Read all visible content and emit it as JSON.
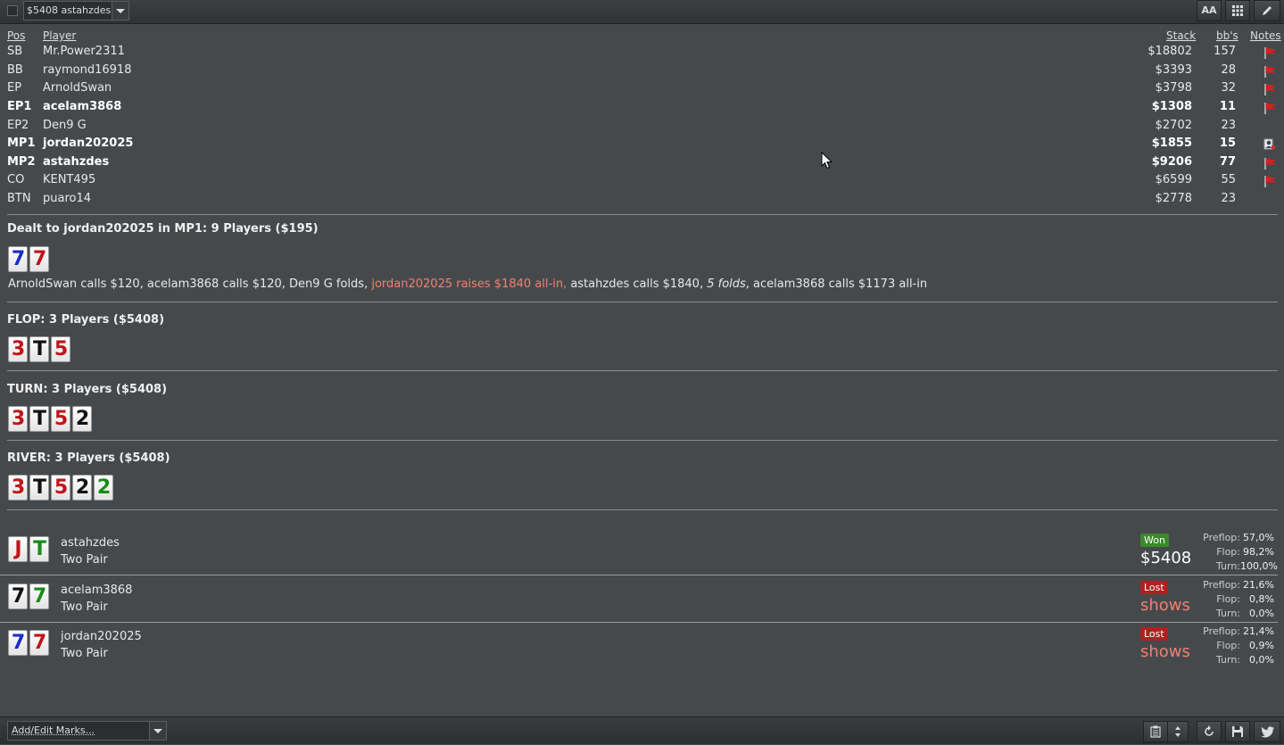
{
  "topbar": {
    "hand_select": "$5408 astahzdes",
    "icons": [
      "font-size-icon",
      "grid-icon",
      "pencil-icon"
    ],
    "font_label": "AA"
  },
  "table": {
    "headers": {
      "pos": "Pos",
      "player": "Player",
      "stack": "Stack",
      "bbs": "bb's",
      "notes": "Notes"
    },
    "rows": [
      {
        "pos": "SB",
        "player": "Mr.Power2311",
        "stack": "$18802",
        "bbs": "157",
        "bold": false,
        "note": "flag"
      },
      {
        "pos": "BB",
        "player": "raymond16918",
        "stack": "$3393",
        "bbs": "28",
        "bold": false,
        "note": "flag"
      },
      {
        "pos": "EP",
        "player": "ArnoldSwan",
        "stack": "$3798",
        "bbs": "32",
        "bold": false,
        "note": "flag"
      },
      {
        "pos": "EP1",
        "player": "acelam3868",
        "stack": "$1308",
        "bbs": "11",
        "bold": true,
        "note": "flag"
      },
      {
        "pos": "EP2",
        "player": "Den9 G",
        "stack": "$2702",
        "bbs": "23",
        "bold": false,
        "note": ""
      },
      {
        "pos": "MP1",
        "player": "jordan202025",
        "stack": "$1855",
        "bbs": "15",
        "bold": true,
        "note": "hero"
      },
      {
        "pos": "MP2",
        "player": "astahzdes",
        "stack": "$9206",
        "bbs": "77",
        "bold": true,
        "note": "flag"
      },
      {
        "pos": "CO",
        "player": "KENT495",
        "stack": "$6599",
        "bbs": "55",
        "bold": false,
        "note": "flag"
      },
      {
        "pos": "BTN",
        "player": "puaro14",
        "stack": "$2778",
        "bbs": "23",
        "bold": false,
        "note": ""
      }
    ]
  },
  "preflop": {
    "title": "Dealt to jordan202025 in MP1: 9 Players ($195)",
    "cards": [
      {
        "rank": "7",
        "suit": "d"
      },
      {
        "rank": "7",
        "suit": "h"
      }
    ],
    "actions": [
      {
        "text": "ArnoldSwan calls $120, acelam3868 calls $120, Den9 G folds, ",
        "style": ""
      },
      {
        "text": "jordan202025 raises $1840 all-in,",
        "style": "hl"
      },
      {
        "text": " astahzdes calls $1840, ",
        "style": ""
      },
      {
        "text": "5 folds",
        "style": "it"
      },
      {
        "text": ", acelam3868 calls $1173 all-in",
        "style": ""
      }
    ]
  },
  "flop": {
    "title": "FLOP: 3 Players ($5408)",
    "cards": [
      {
        "rank": "3",
        "suit": "h"
      },
      {
        "rank": "T",
        "suit": "s"
      },
      {
        "rank": "5",
        "suit": "h"
      }
    ]
  },
  "turn": {
    "title": "TURN: 3 Players ($5408)",
    "cards": [
      {
        "rank": "3",
        "suit": "h"
      },
      {
        "rank": "T",
        "suit": "s"
      },
      {
        "rank": "5",
        "suit": "h"
      },
      {
        "rank": "2",
        "suit": "s"
      }
    ]
  },
  "river": {
    "title": "RIVER: 3 Players ($5408)",
    "cards": [
      {
        "rank": "3",
        "suit": "h"
      },
      {
        "rank": "T",
        "suit": "s"
      },
      {
        "rank": "5",
        "suit": "h"
      },
      {
        "rank": "2",
        "suit": "s"
      },
      {
        "rank": "2",
        "suit": "c"
      }
    ]
  },
  "showdown": [
    {
      "player": "astahzdes",
      "hand": "Two Pair",
      "cards": [
        {
          "rank": "J",
          "suit": "h"
        },
        {
          "rank": "T",
          "suit": "c"
        }
      ],
      "result": "Won",
      "amount": "$5408",
      "equity": [
        {
          "k": "Preflop:",
          "v": "57,0%"
        },
        {
          "k": "Flop:",
          "v": "98,2%"
        },
        {
          "k": "Turn:",
          "v": "100,0%"
        }
      ]
    },
    {
      "player": "acelam3868",
      "hand": "Two Pair",
      "cards": [
        {
          "rank": "7",
          "suit": "s"
        },
        {
          "rank": "7",
          "suit": "c"
        }
      ],
      "result": "Lost",
      "amount": "shows",
      "equity": [
        {
          "k": "Preflop:",
          "v": "21,6%"
        },
        {
          "k": "Flop:",
          "v": "0,8%"
        },
        {
          "k": "Turn:",
          "v": "0,0%"
        }
      ]
    },
    {
      "player": "jordan202025",
      "hand": "Two Pair",
      "cards": [
        {
          "rank": "7",
          "suit": "d"
        },
        {
          "rank": "7",
          "suit": "h"
        }
      ],
      "result": "Lost",
      "amount": "shows",
      "equity": [
        {
          "k": "Preflop:",
          "v": "21,4%"
        },
        {
          "k": "Flop:",
          "v": "0,9%"
        },
        {
          "k": "Turn:",
          "v": "0,0%"
        }
      ]
    }
  ],
  "bottombar": {
    "marks_placeholder": "Add/Edit Marks...",
    "icons": [
      "clipboard-icon",
      "sort-arrows-icon",
      "refresh-icon",
      "save-icon",
      "twitter-icon"
    ]
  },
  "colors": {
    "background": "#46494c",
    "highlight": "#f08070",
    "won": "#3a8a2a",
    "lost": "#b02020"
  }
}
